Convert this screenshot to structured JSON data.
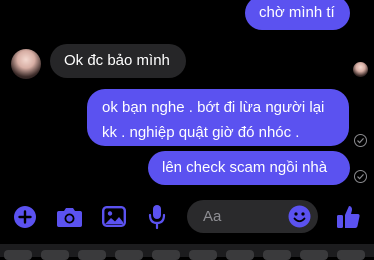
{
  "messages": {
    "out_top": "chờ mình tí",
    "in_1": "Ok đc bảo mình",
    "out_1_line1": "ok bạn nghe . bớt đi lừa người lại",
    "out_1_line2": "kk . nghiệp quật giờ đó nhóc .",
    "out_2": "lên check scam ngồi nhà"
  },
  "composer": {
    "placeholder": "Aa",
    "icons": [
      "plus-icon",
      "camera-icon",
      "image-icon",
      "microphone-icon",
      "emoji-icon",
      "like-icon"
    ]
  },
  "colors": {
    "accent": "#5b52f0",
    "incoming_bubble": "#262628",
    "background": "#000000"
  }
}
